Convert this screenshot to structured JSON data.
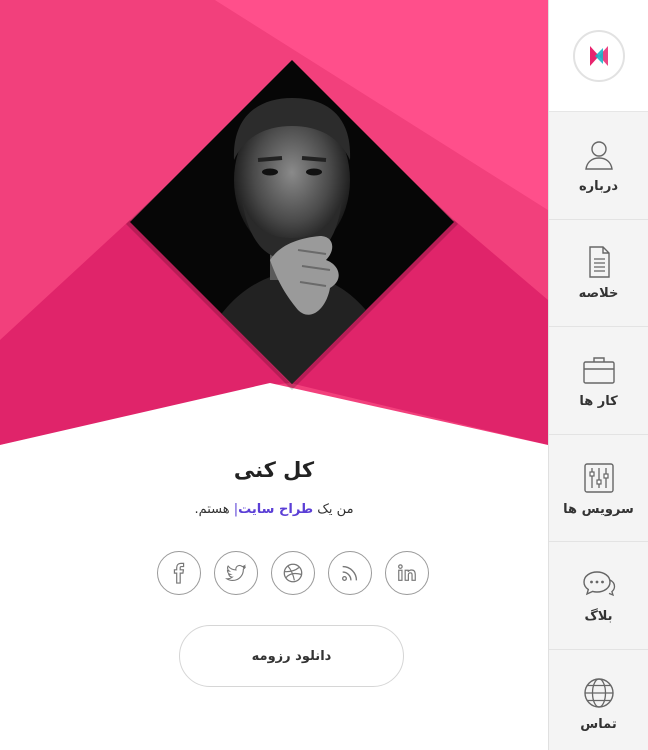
{
  "profile": {
    "name": "کل کنی",
    "tagline_prefix": "من یک",
    "tagline_highlight": "طراح سایت",
    "tagline_caret": "|",
    "tagline_suffix": "هستم.",
    "download_label": "دانلود رزومه"
  },
  "socials": [
    {
      "icon": "facebook-icon"
    },
    {
      "icon": "twitter-icon"
    },
    {
      "icon": "dribbble-icon"
    },
    {
      "icon": "rss-icon"
    },
    {
      "icon": "linkedin-icon"
    }
  ],
  "sidebar": {
    "logo_icon": "brand-logo-icon",
    "items": [
      {
        "label": "درباره",
        "icon": "user-icon"
      },
      {
        "label": "خلاصه",
        "icon": "document-icon"
      },
      {
        "label": "کار ها",
        "icon": "briefcase-icon"
      },
      {
        "label": "سرویس ها",
        "icon": "sliders-icon"
      },
      {
        "label": "بلاگ",
        "icon": "chat-icon"
      },
      {
        "label": "تماس",
        "icon": "globe-icon"
      }
    ]
  },
  "colors": {
    "hero_pink_light": "#ff4f8b",
    "hero_pink_mid": "#f2407c",
    "hero_pink_dark": "#e0246a",
    "accent_purple": "#5b3fd6"
  }
}
